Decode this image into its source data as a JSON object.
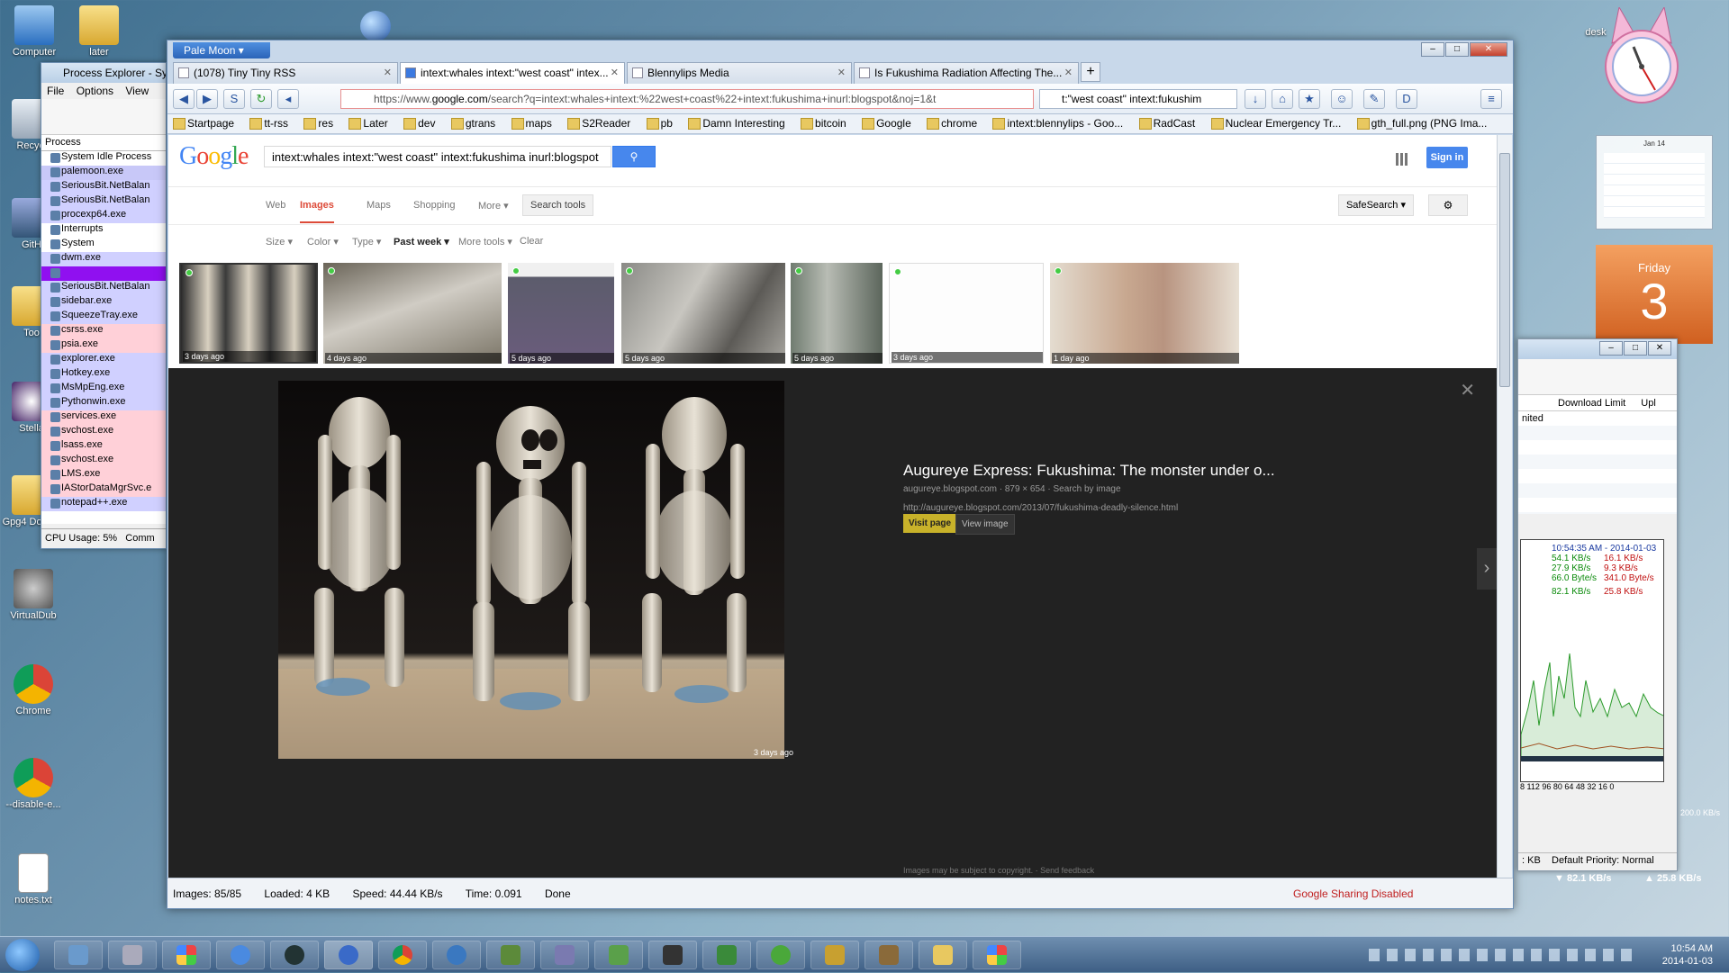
{
  "desktop": {
    "icons": [
      "Computer",
      "later",
      "Recycl",
      "GitH",
      "Too",
      "Stella",
      "Gpg4 Docum",
      "VirtualDub",
      "Chrome",
      "--disable-e...",
      "notes.txt",
      "desk"
    ]
  },
  "process_explorer": {
    "title": "Process Explorer - Sy",
    "menu": [
      "File",
      "Options",
      "View"
    ],
    "column": "Process",
    "processes": [
      "System Idle Process",
      "palemoon.exe",
      "SeriousBit.NetBalan",
      "SeriousBit.NetBalan",
      "procexp64.exe",
      "Interrupts",
      "System",
      "dwm.exe",
      "",
      "SeriousBit.NetBalan",
      "sidebar.exe",
      "SqueezeTray.exe",
      "csrss.exe",
      "psia.exe",
      "explorer.exe",
      "Hotkey.exe",
      "MsMpEng.exe",
      "Pythonwin.exe",
      "services.exe",
      "svchost.exe",
      "lsass.exe",
      "svchost.exe",
      "LMS.exe",
      "IAStorDataMgrSvc.e",
      "notepad++.exe"
    ],
    "status": "CPU Usage: 5%",
    "status2": "Comm"
  },
  "browser": {
    "app_button": "Pale Moon",
    "tabs": [
      "(1078) Tiny Tiny RSS",
      "intext:whales intext:\"west coast\" intex...",
      "Blennylips Media",
      "Is Fukushima Radiation Affecting The..."
    ],
    "url_prefix": "https://www.",
    "url_host": "google.com",
    "url_rest": "/search?q=intext:whales+intext:%22west+coast%22+intext:fukushima+inurl:blogspot&noj=1&t",
    "search_value": "t:\"west coast\" intext:fukushim",
    "bookmarks": [
      "Startpage",
      "tt-rss",
      "res",
      "Later",
      "dev",
      "gtrans",
      "maps",
      "S2Reader",
      "pb",
      "Damn Interesting",
      "bitcoin",
      "Google",
      "chrome",
      "intext:blennylips - Goo...",
      "RadCast",
      "Nuclear Emergency Tr...",
      "gth_full.png (PNG Ima..."
    ],
    "status": {
      "images": "Images: 85/85",
      "loaded": "Loaded: 4 KB",
      "speed": "Speed: 44.44 KB/s",
      "time": "Time: 0.091",
      "done": "Done",
      "sharing": "Google Sharing Disabled"
    }
  },
  "google": {
    "logo": "Google",
    "query": "intext:whales intext:\"west coast\" intext:fukushima inurl:blogspot",
    "signin": "Sign in",
    "nav": [
      "Web",
      "Images",
      "Maps",
      "Shopping",
      "More ▾"
    ],
    "search_tools": "Search tools",
    "safesearch": "SafeSearch ▾",
    "filters": [
      "Size ▾",
      "Color ▾",
      "Type ▾",
      "Past week ▾",
      "More tools ▾",
      "Clear"
    ],
    "thumb_ages": [
      "3 days ago",
      "4 days ago",
      "5 days ago",
      "5 days ago",
      "5 days ago",
      "3 days ago",
      "1 day ago"
    ],
    "preview": {
      "title": "Augureye Express: Fukushima: The monster under o...",
      "subtitle": "augureye.blogspot.com · 879 × 654 · Search by image",
      "url": "http://augureye.blogspot.com/2013/07/fukushima-deadly-silence.html",
      "visit": "Visit page",
      "view": "View image",
      "caption": "3 days ago",
      "copyright": "Images may be subject to copyright. · Send feedback"
    }
  },
  "calendar": {
    "month": "Jan 14",
    "weekday": "Friday",
    "day": "3"
  },
  "net_monitor": {
    "headers": [
      "Download Limit",
      "Upl"
    ],
    "row1": "nited",
    "timestamp": "10:54:35 AM - 2014-01-03",
    "rates": [
      [
        "54.1 KB/s",
        "16.1 KB/s"
      ],
      [
        "27.9 KB/s",
        "9.3 KB/s"
      ],
      [
        "66.0 Byte/s",
        "341.0 Byte/s"
      ],
      [
        "82.1 KB/s",
        "25.8 KB/s"
      ]
    ],
    "axis": "8 112 96 80 64 48 32 16 0",
    "priority": "Default Priority: Normal",
    "kb": ": KB",
    "rate_side": "200.0 KB/s"
  },
  "taskbar": {
    "down": "82.1 KB/s",
    "up": "25.8 KB/s",
    "time": "10:54 AM",
    "date": "2014-01-03"
  }
}
